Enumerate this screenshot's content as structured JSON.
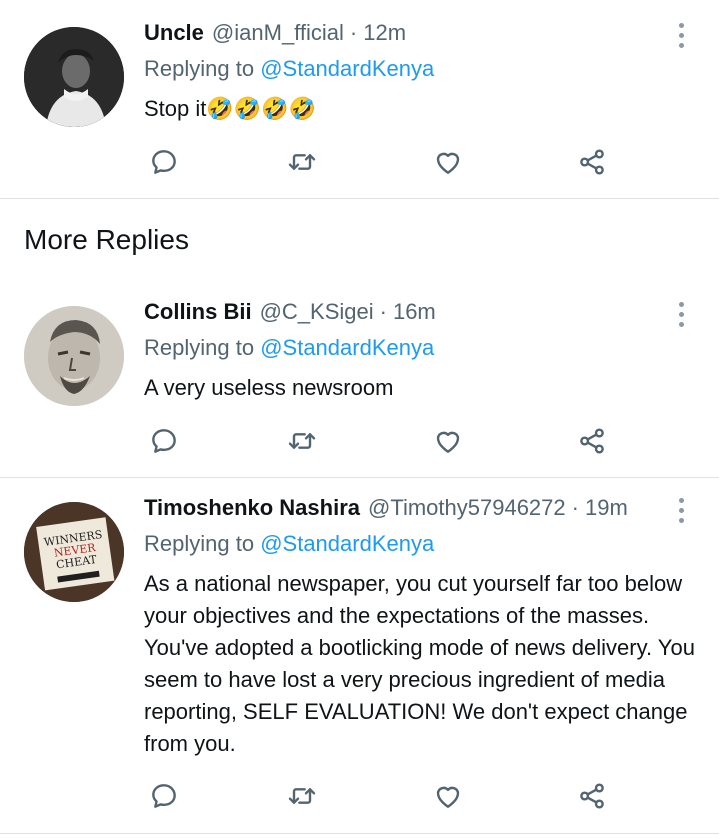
{
  "section_title": "More Replies",
  "replying_prefix": "Replying to",
  "dot": "·",
  "replies": [
    {
      "name": "Uncle",
      "handle": "@ianM_fficial",
      "time": "12m",
      "replying_to": "@StandardKenya",
      "text": "Stop it",
      "emoji": "🤣🤣🤣🤣"
    },
    {
      "name": "Collins Bii",
      "handle": "@C_KSigei",
      "time": "16m",
      "replying_to": "@StandardKenya",
      "text": "A very useless newsroom"
    },
    {
      "name": "Timoshenko Nashira",
      "handle": "@Timothy57946272",
      "time": "19m",
      "replying_to": "@StandardKenya",
      "text": "As a national newspaper, you cut yourself far too below your objectives and the expectations of the masses. You've adopted a bootlicking mode of news delivery. You seem to have lost a very precious ingredient of media reporting, SELF EVALUATION!  We don't expect change from you.",
      "avatar_book_title": "WINNERS NEVER CHEAT"
    }
  ],
  "icons": {
    "reply": "speech-bubble-icon",
    "retweet": "retweet-icon",
    "like": "heart-icon",
    "share": "share-icon",
    "more": "more-dots-icon"
  },
  "colors": {
    "link": "#1d9bf0",
    "secondary": "#536471",
    "separator": "#dfe3e6"
  }
}
